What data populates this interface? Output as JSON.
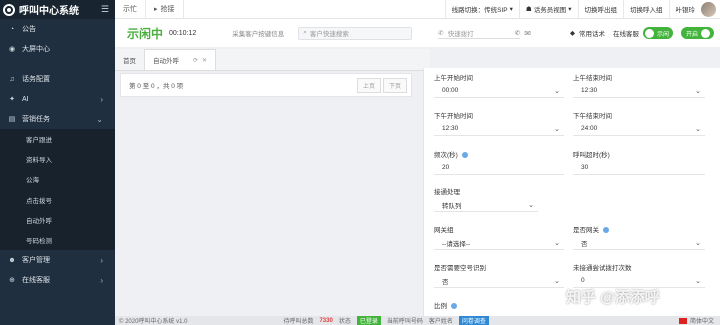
{
  "app": {
    "title": "呼叫中心系统",
    "menu_icon": "menu-icon"
  },
  "sidebar": {
    "items": [
      {
        "label": "公告",
        "icon": "bell-icon"
      },
      {
        "label": "大屏中心",
        "icon": "screen-icon"
      },
      {
        "label": "话务配置",
        "icon": "headset-icon"
      },
      {
        "label": "AI",
        "icon": "ai-icon"
      },
      {
        "label": "营销任务",
        "icon": "task-icon"
      },
      {
        "label": "客户管理",
        "icon": "user-icon"
      },
      {
        "label": "在线客服",
        "icon": "globe-icon"
      }
    ],
    "sub_items": [
      "客户跟进",
      "资料导入",
      "公海",
      "点击拨号",
      "自动外呼",
      "号码检测"
    ]
  },
  "topbar": {
    "busy": "示忙",
    "grab": "抢接",
    "line_switch": "线路切换：传统SIP",
    "agent_view": "话务员视图",
    "switch_out": "切换呼出组",
    "switch_in": "切换呼入组",
    "user": "叶银玲"
  },
  "status": {
    "state": "示闲中",
    "timer": "00:10:12",
    "collect": "采集客户按键信息",
    "search_placeholder": "客户快速搜索",
    "dial_placeholder": "快速拨打",
    "common_script": "常用话术",
    "online_help": "在线客服",
    "toggle_off": "示闲",
    "toggle_on": "开启"
  },
  "tabs": [
    {
      "label": "首页"
    },
    {
      "label": "自动外呼"
    }
  ],
  "list": {
    "summary": "第 0 至 0 ，共 0 项",
    "prev": "上页",
    "next": "下页"
  },
  "form": {
    "am_start_label": "上午开始时间",
    "am_start": "00:00",
    "am_end_label": "上午结束时间",
    "am_end": "12:30",
    "pm_start_label": "下午开始时间",
    "pm_start": "12:30",
    "pm_end_label": "下午结束时间",
    "pm_end": "24:00",
    "freq_label": "频次(秒)",
    "freq": "20",
    "timeout_label": "呼叫超时(秒)",
    "timeout": "30",
    "connect_label": "接通处理",
    "connect": "转队列",
    "gateway_label": "网关组",
    "gateway": "--请选择--",
    "is_gateway_label": "是否网关",
    "is_gateway": "否",
    "blank_label": "是否需要空号识别",
    "blank": "否",
    "retry_label": "未接通尝试拨打次数",
    "retry": "0",
    "ratio_label": "比例"
  },
  "footer": {
    "copyright": "© 2020呼叫中心系统 v1.0",
    "waiting": "待呼叫总数",
    "waiting_count": "7330",
    "state_label": "状态",
    "state_value": "已登录",
    "current_label": "当前呼叫号码",
    "customer_label": "客户姓名",
    "survey": "问卷调查",
    "lang": "简体中文"
  },
  "watermark": "知乎 @添添呼"
}
